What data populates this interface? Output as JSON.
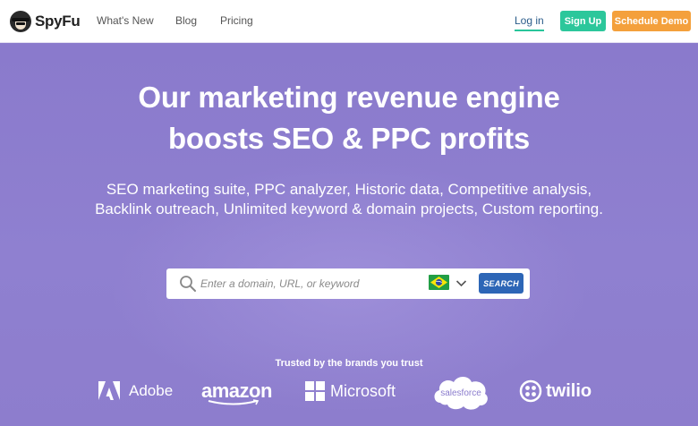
{
  "brand": {
    "name": "SpyFu"
  },
  "nav": {
    "links": [
      "What's New",
      "Blog",
      "Pricing"
    ],
    "login": "Log in",
    "signup": "Sign Up",
    "demo": "Schedule Demo"
  },
  "hero": {
    "headline_line1": "Our marketing revenue engine",
    "headline_line2": "boosts SEO & PPC profits",
    "subhead": "SEO marketing suite, PPC analyzer, Historic data, Competitive analysis, Backlink outreach, Unlimited keyword & domain projects, Custom reporting."
  },
  "search": {
    "placeholder": "Enter a domain, URL, or keyword",
    "country_flag": "brazil-flag",
    "button": "SEARCH"
  },
  "trusted": {
    "heading": "Trusted by the brands you trust",
    "brands": [
      "Adobe",
      "amazon",
      "Microsoft",
      "salesforce",
      "twilio"
    ]
  },
  "colors": {
    "hero_bg": "#8b7ccd",
    "signup": "#2cc79b",
    "demo": "#f4a03c",
    "search_button": "#2d66b6",
    "login_underline": "#28c59b"
  }
}
